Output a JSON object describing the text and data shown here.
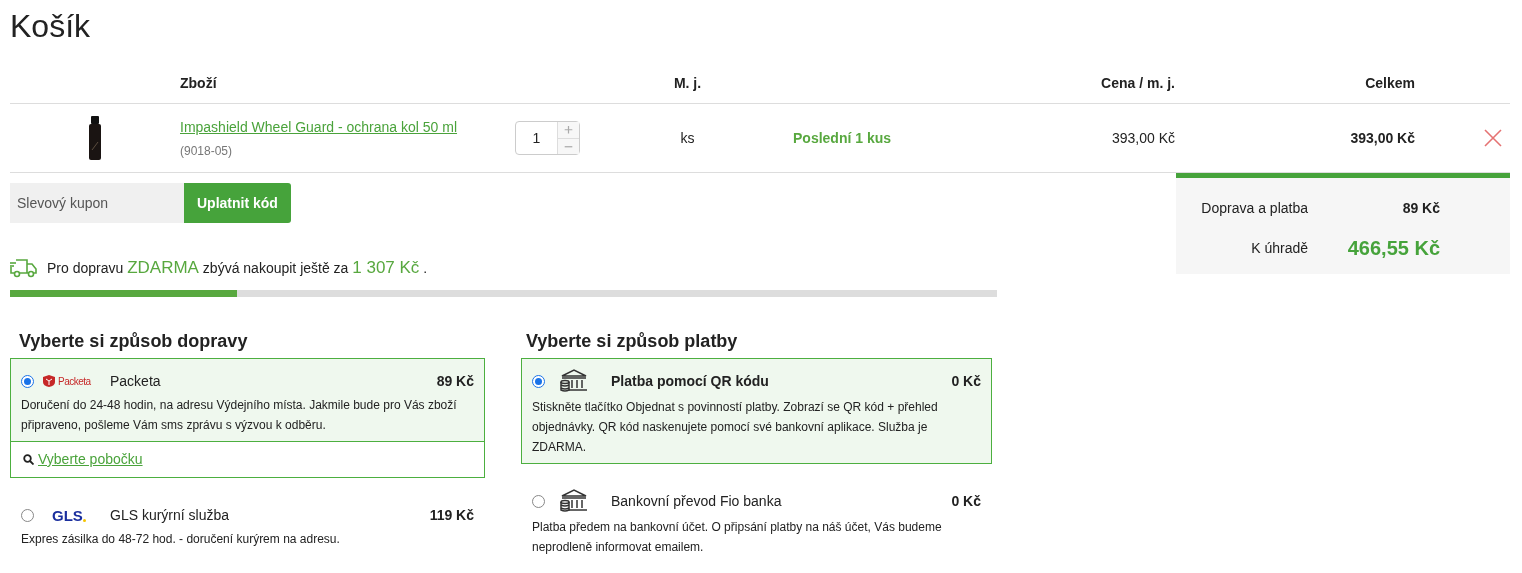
{
  "title": "Košík",
  "cart": {
    "headers": {
      "product": "Zboží",
      "unit": "M. j.",
      "price": "Cena / m. j.",
      "total": "Celkem"
    },
    "items": [
      {
        "name": "Impashield Wheel Guard - ochrana kol 50 ml",
        "code": "(9018-05)",
        "quantity": "1",
        "unit": "ks",
        "stock": "Poslední 1 kus",
        "price": "393,00 Kč",
        "total": "393,00 Kč"
      }
    ]
  },
  "coupon": {
    "placeholder": "Slevový kupon",
    "button": "Uplatnit kód"
  },
  "summary": [
    {
      "kind": "normal",
      "label": "Doprava a platba",
      "value": "89 Kč"
    },
    {
      "kind": "total",
      "label": "K úhradě",
      "value": "466,55 Kč"
    }
  ],
  "free_shipping": {
    "prefix": "Pro dopravu",
    "highlight": "ZDARMA",
    "middle": "zbývá nakoupit ještě za",
    "amount": "1 307 Kč",
    "suffix": ".",
    "level": 0.23
  },
  "shipping": {
    "heading": "Vyberte si způsob dopravy",
    "options": [
      {
        "kind": "packeta",
        "logo_text": "Packeta",
        "name": "Packeta",
        "price": "89 Kč",
        "description": "Doručení do 24-48 hodin, na adresu Výdejního místa. Jakmile bude pro Vás zboží připraveno, pošleme Vám sms zprávu s výzvou k odběru.",
        "link": "Vyberte pobočku",
        "selected": true
      },
      {
        "kind": "gls",
        "logo_text": "GLS",
        "name": "GLS kurýrní služba",
        "price": "119 Kč",
        "description": "Expres zásilka do 48-72 hod. - doručení kurýrem na adresu.",
        "selected": false
      }
    ]
  },
  "payment": {
    "heading": "Vyberte si způsob platby",
    "options": [
      {
        "name": "Platba pomocí QR kódu",
        "price": "0 Kč",
        "description": "Stiskněte tlačítko Objednat s povinností platby. Zobrazí se QR kód + přehled objednávky. QR kód naskenujete pomocí své bankovní aplikace. Služba je ZDARMA.",
        "selected": true
      },
      {
        "name": "Bankovní převod Fio banka",
        "price": "0 Kč",
        "description": "Platba předem na bankovní účet. O připsání platby na náš účet, Vás budeme neprodleně informovat emailem.",
        "selected": false
      }
    ]
  }
}
